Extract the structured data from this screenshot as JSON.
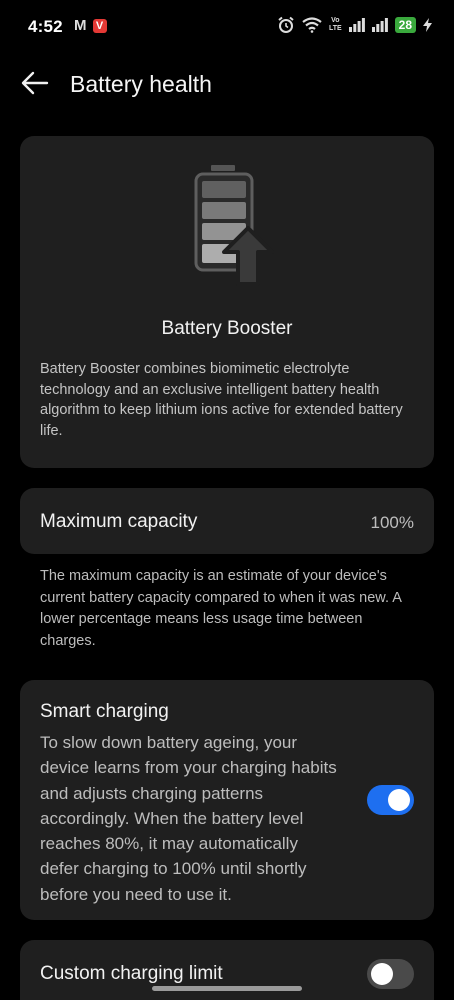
{
  "status_bar": {
    "time": "4:52",
    "gmail_icon": "M",
    "app_icon": "V",
    "volte": "Vo\nLTE",
    "battery": "28"
  },
  "header": {
    "title": "Battery health",
    "back_icon": "arrow-left"
  },
  "booster": {
    "title": "Battery Booster",
    "description": "Battery Booster combines biomimetic electrolyte technology and an exclusive intelligent battery health algorithm to keep lithium ions active for extended battery life."
  },
  "capacity": {
    "label": "Maximum capacity",
    "value": "100%",
    "description": "The maximum capacity is an estimate of your device's current battery capacity compared to when it was new. A lower percentage means less usage time between charges."
  },
  "smart_charging": {
    "label": "Smart charging",
    "description": "To slow down battery ageing, your device learns from your charging habits and adjusts charging patterns accordingly. When the battery level reaches 80%, it may automatically defer charging to 100% until shortly before you need to use it.",
    "enabled": true
  },
  "charging_limit": {
    "label": "Custom charging limit",
    "enabled": false
  },
  "colors": {
    "background": "#000000",
    "card": "#1f1f1f",
    "accent": "#1e6ff0",
    "battery_green": "#3aa93d"
  }
}
